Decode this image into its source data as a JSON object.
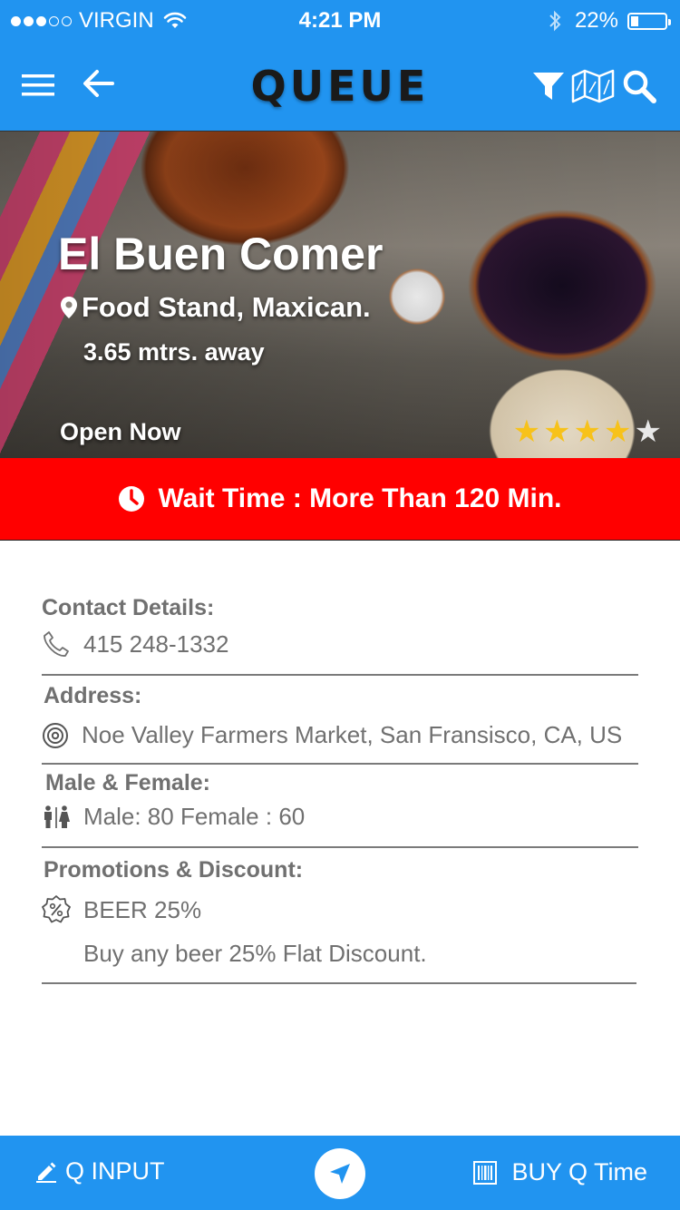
{
  "status_bar": {
    "carrier": "VIRGIN",
    "time": "4:21 PM",
    "battery": "22%"
  },
  "nav": {
    "title": "QUEUE",
    "icons": [
      "menu-icon",
      "back-arrow-icon",
      "filter-icon",
      "map-icon",
      "search-icon"
    ]
  },
  "venue": {
    "name": "El Buen Comer",
    "category": "Food Stand, Maxican.",
    "distance": "3.65 mtrs. away",
    "open_status": "Open Now",
    "rating": 4,
    "rating_max": 5
  },
  "wait": {
    "text": "Wait Time : More Than 120 Min."
  },
  "details": {
    "contact_title": "Contact Details:",
    "phone": "415 248-1332",
    "address_title": "Address:",
    "address": "Noe Valley Farmers Market, San Fransisco, CA, US",
    "gender_title": "Male & Female:",
    "gender_ratio": "Male: 80 Female : 60",
    "promo_title": "Promotions & Discount:",
    "promo_name": "BEER 25%",
    "promo_desc": "Buy any beer 25% Flat Discount."
  },
  "bottom_bar": {
    "left_label": "Q INPUT",
    "right_label": "BUY Q Time"
  },
  "colors": {
    "primary": "#2194f0",
    "wait_banner": "#ff0000",
    "star": "#f7c21a",
    "text_gray": "#707070"
  }
}
